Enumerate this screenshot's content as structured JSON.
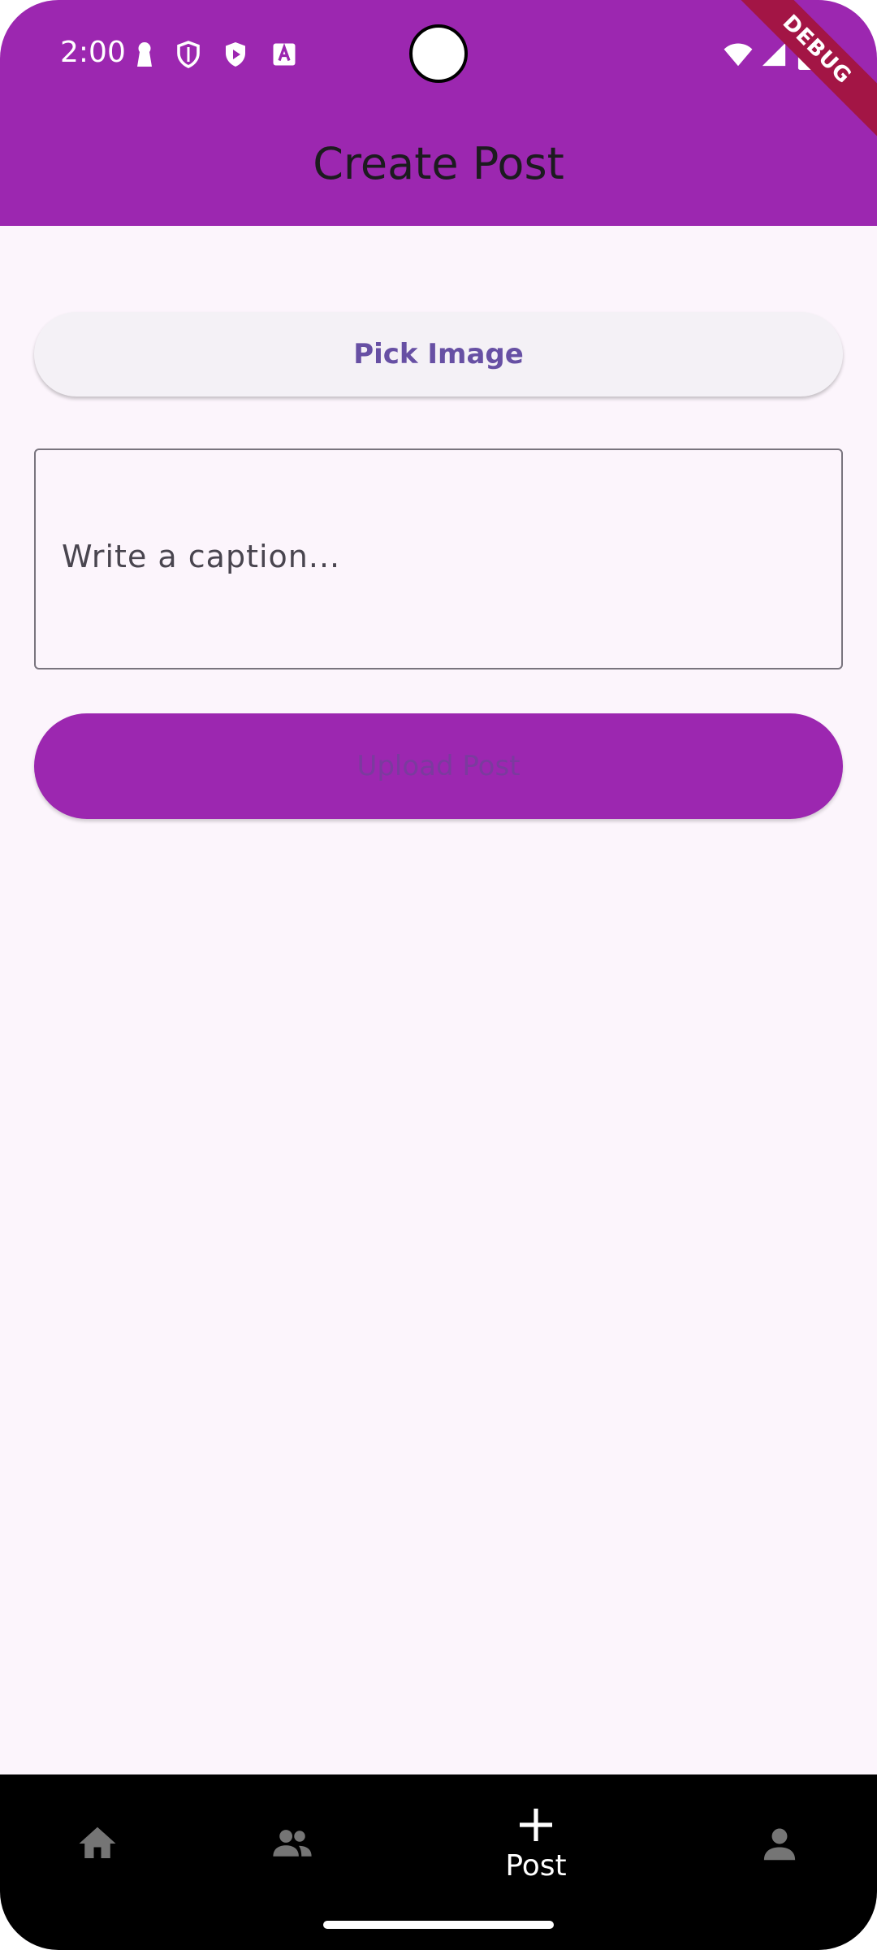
{
  "status_bar": {
    "time": "2:00",
    "debug_banner": "DEBUG"
  },
  "header": {
    "title": "Create Post"
  },
  "form": {
    "pick_image_label": "Pick Image",
    "caption_placeholder": "Write a caption...",
    "caption_value": "",
    "upload_label": "Upload Post"
  },
  "bottom_nav": {
    "items": [
      {
        "icon": "home-icon",
        "label": ""
      },
      {
        "icon": "people-icon",
        "label": ""
      },
      {
        "icon": "add-icon",
        "label": "Post"
      },
      {
        "icon": "person-icon",
        "label": ""
      }
    ],
    "active_index": 2
  },
  "colors": {
    "app_bar": "#9c27b0",
    "background": "#fcf5fc",
    "pick_button_text": "#6750a4",
    "bottom_nav": "#000000"
  }
}
